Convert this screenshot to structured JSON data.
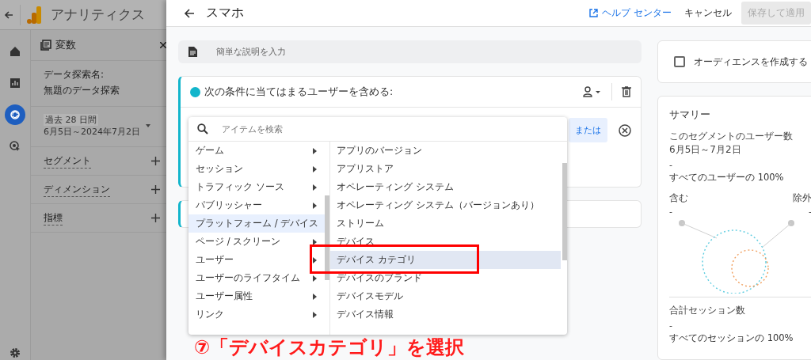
{
  "app_header": {
    "title": "アナリティクス"
  },
  "nav_rail": [
    {
      "kind": "home",
      "selected": false
    },
    {
      "kind": "reports",
      "selected": false
    },
    {
      "kind": "explore",
      "selected": true
    },
    {
      "kind": "advertising",
      "selected": false
    }
  ],
  "variables_panel": {
    "title": "変数",
    "name_label": "データ探索名:",
    "name": "無題のデータ探索",
    "date_badge": "過去 28 日間",
    "date_range": "6月5日～2024年7月2日",
    "sections": [
      "セグメント",
      "ディメンション",
      "指標"
    ]
  },
  "editor": {
    "title": "スマホ",
    "help_link": "ヘルプ センター",
    "cancel": "キャンセル",
    "save": {
      "label": "保存して適用",
      "disabled": true
    },
    "description_placeholder": "簡単な説明を入力",
    "condition_title": "次の条件に当てはまるユーザーを含める:",
    "or_button": "または",
    "dropdown": {
      "search_placeholder": "アイテムを検索",
      "categories": [
        {
          "label": "ゲーム",
          "selected": false
        },
        {
          "label": "セッション",
          "selected": false
        },
        {
          "label": "トラフィック ソース",
          "selected": false
        },
        {
          "label": "パブリッシャー",
          "selected": false
        },
        {
          "label": "プラットフォーム / デバイス",
          "selected": true
        },
        {
          "label": "ページ / スクリーン",
          "selected": false
        },
        {
          "label": "ユーザー",
          "selected": false
        },
        {
          "label": "ユーザーのライフタイム",
          "selected": false
        },
        {
          "label": "ユーザー属性",
          "selected": false
        },
        {
          "label": "リンク",
          "selected": false
        }
      ],
      "items": [
        {
          "label": "アプリのバージョン",
          "selected": false
        },
        {
          "label": "アプリストア",
          "selected": false
        },
        {
          "label": "オペレーティング システム",
          "selected": false
        },
        {
          "label": "オペレーティング システム（バージョンあり）",
          "selected": false
        },
        {
          "label": "ストリーム",
          "selected": false
        },
        {
          "label": "デバイス",
          "selected": false
        },
        {
          "label": "デバイス カテゴリ",
          "selected": true
        },
        {
          "label": "デバイスのブランド",
          "selected": false
        },
        {
          "label": "デバイスモデル",
          "selected": false
        },
        {
          "label": "デバイス情報",
          "selected": false
        }
      ]
    }
  },
  "annotation": {
    "text": "⑦「デバイスカテゴリ」を選択"
  },
  "audience": {
    "label": "オーディエンスを作成する",
    "checked": false
  },
  "summary": {
    "title": "サマリー",
    "users_label": "このセグメントのユーザー数",
    "users_range": "6月5日～7月2日",
    "users_value": "-",
    "users_share": "すべてのユーザーの 100%",
    "include_label": "含む",
    "exclude_label": "除外",
    "include_value": "-",
    "exclude_value": "-",
    "sessions_label": "合計セッション数",
    "sessions_value": "-",
    "sessions_share": "すべてのセッションの 100%"
  }
}
